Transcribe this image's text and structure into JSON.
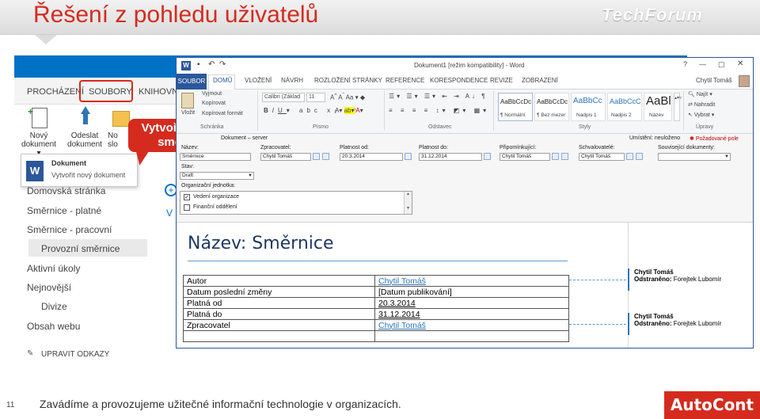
{
  "slide": {
    "title": "Řešení z pohledu uživatelů",
    "brand_logo": "TechForum",
    "page_number": "11",
    "footer_text": "Zavádíme a provozujeme užitečné informační technologie v organizacích.",
    "footer_logo": "AutoCont",
    "accent_color": "#d52b1e"
  },
  "callout": {
    "line1": "Vytvoření nové",
    "line2": "směrnice"
  },
  "sharepoint": {
    "tabs": [
      "PROCHÁZENÍ",
      "SOUBORY",
      "KNIHOVNA"
    ],
    "buttons": {
      "new_line1": "Nový",
      "new_line2": "dokument ▾",
      "upload_line1": "Odeslat",
      "upload_line2": "dokument",
      "third_line1": "No",
      "third_line2": "slo"
    },
    "menu": {
      "title": "Dokument",
      "subtitle": "Vytvořit nový dokument"
    },
    "nav": [
      "Domovská stránka",
      "Směrnice - platné",
      "Směrnice - pracovní",
      "Provozní směrnice",
      "Aktivní úkoly",
      "Nejnovější",
      "Divize",
      "Obsah webu"
    ],
    "edit_links": "UPRAVIT ODKAZY",
    "partial_text": "V"
  },
  "word": {
    "title": "Dokument1 [režim kompatibility] - Word",
    "user": "Chytil Tomáš",
    "tabs": [
      "SOUBOR",
      "DOMŮ",
      "VLOŽENÍ",
      "NÁVRH",
      "ROZLOŽENÍ STRÁNKY",
      "REFERENCE",
      "KORESPONDENCE",
      "REVIZE",
      "ZOBRAZENÍ"
    ],
    "ribbon": {
      "paste": "Vložit",
      "cut": "Vyjmout",
      "copy": "Kopírovat",
      "format_painter": "Kopírovat formát",
      "clipboard_group": "Schránka",
      "font_name": "Calibri (Základ",
      "font_size": "11",
      "font_group": "Písmo",
      "paragraph_group": "Odstavec",
      "styles_group": "Styly",
      "editing_group": "Úpravy",
      "find": "Najít",
      "replace": "Nahradit",
      "select": "Vybrat",
      "styles": [
        {
          "preview": "AaBbCcDc",
          "name": "¶ Normální"
        },
        {
          "preview": "AaBbCcDc",
          "name": "¶ Bez mezer"
        },
        {
          "preview": "AaBbCc",
          "name": "Nadpis 1"
        },
        {
          "preview": "AaBbCcC",
          "name": "Nadpis 2"
        },
        {
          "preview": "AaBl",
          "name": "Název"
        }
      ]
    },
    "docinfo": {
      "content_type": "Dokument – server",
      "location": "Umístění: neuloženo",
      "required_fields": "Požadované pole",
      "name_label": "Název:",
      "name_value": "Směrnice",
      "processor_label": "Zpracovatel:",
      "processor_value": "Chytil Tomáš",
      "valid_from_label": "Platnost od:",
      "valid_from_value": "20.3.2014",
      "valid_to_label": "Platnost do:",
      "valid_to_value": "31.12.2014",
      "reviewer_label": "Připomínkující:",
      "reviewer_value": "Chytil Tomáš",
      "approver_label": "Schvalovatelé:",
      "approver_value": "Chytil Tomáš",
      "related_label": "Související dokumenty:",
      "state_label": "Stav:",
      "state_value": "Draft",
      "org_label": "Organizační jednotka:",
      "org_items": [
        "Vedení organizace",
        "Finanční oddělení"
      ]
    },
    "document": {
      "heading": "Název: Směrnice",
      "rows": [
        [
          "Autor",
          "Chytil Tomáš"
        ],
        [
          "Datum poslední změny",
          "[Datum publikování]"
        ],
        [
          "Platná od",
          "20.3.2014"
        ],
        [
          "Platná do",
          "31.12.2014"
        ],
        [
          "Zpracovatel",
          "Chytil Tomáš"
        ],
        [
          "",
          ""
        ]
      ]
    },
    "comments": [
      {
        "author": "Chytil Tomáš",
        "label": "Odstraněno:",
        "value": "Forejtek Lubomír"
      },
      {
        "author": "Chytil Tomáš",
        "label": "Odstraněno:",
        "value": "Forejtek Lubomír"
      }
    ]
  }
}
